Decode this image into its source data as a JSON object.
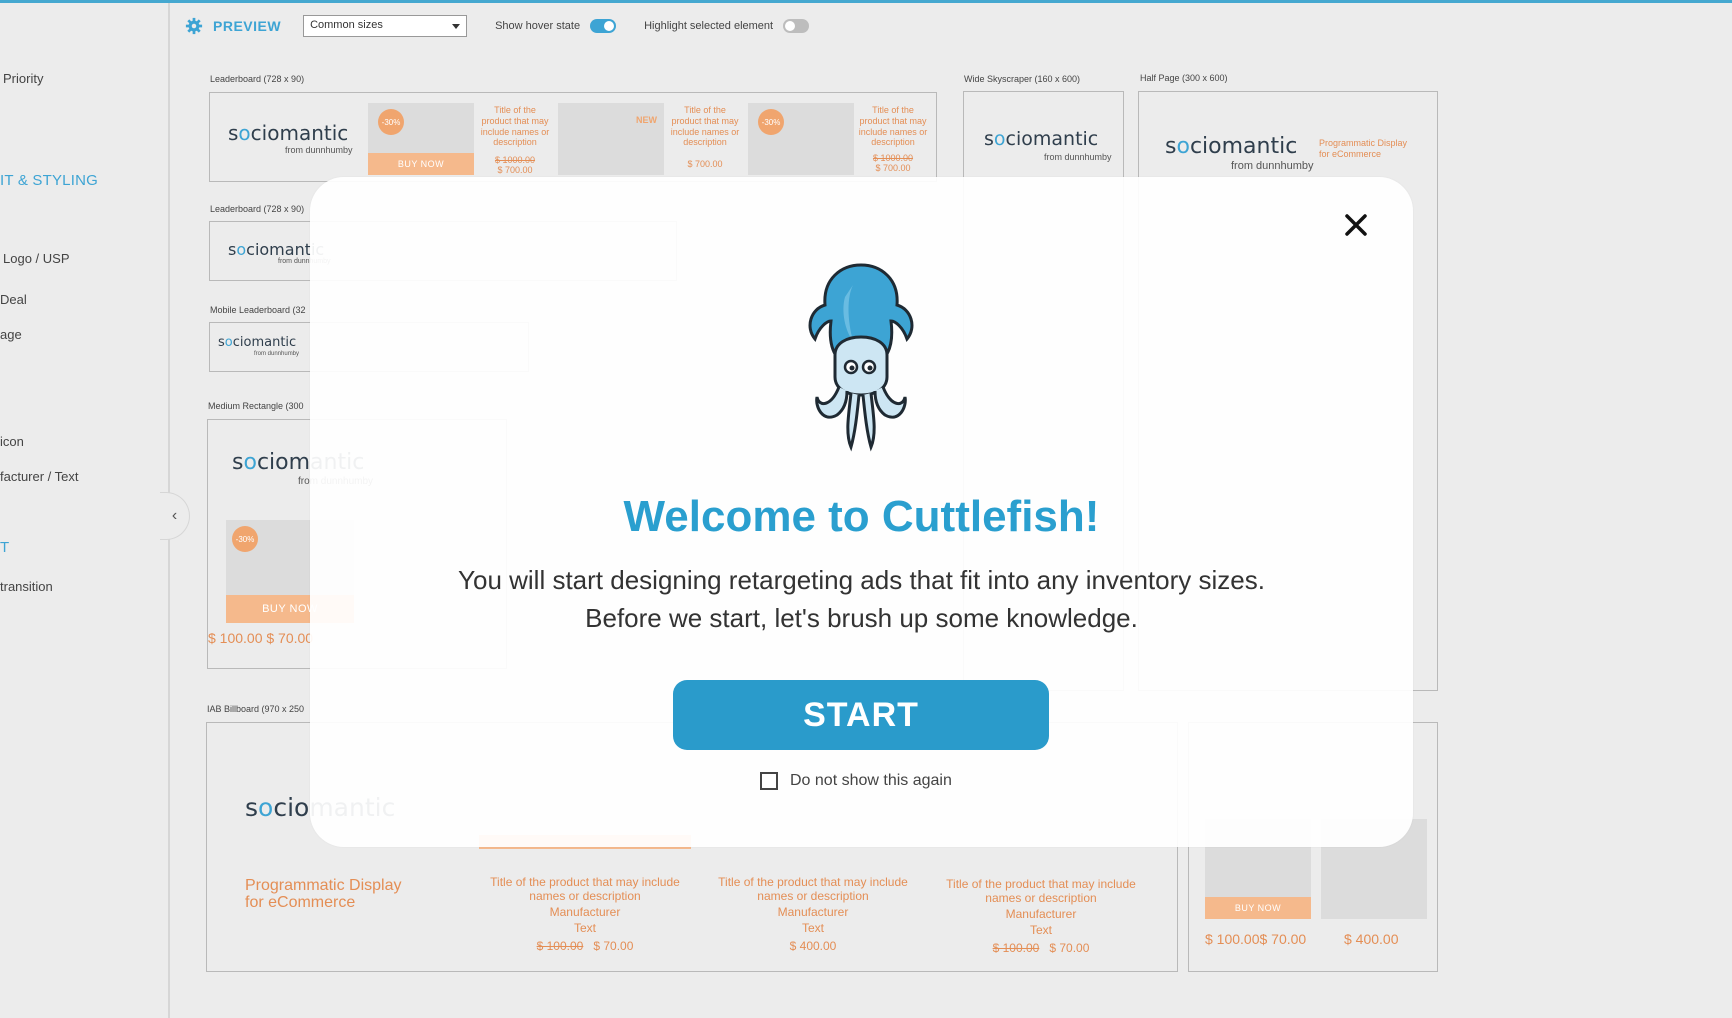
{
  "sidebar": {
    "items": [
      {
        "label": "Priority"
      },
      {
        "label": "IT & STYLING"
      },
      {
        "label": "Logo / USP"
      },
      {
        "label": "Deal"
      },
      {
        "label": "age"
      },
      {
        "label": "icon"
      },
      {
        "label": "facturer / Text"
      },
      {
        "label": "T"
      },
      {
        "label": "transition"
      }
    ]
  },
  "toolbar": {
    "preview_label": "PREVIEW",
    "size_select_value": "Common sizes",
    "show_hover_label": "Show hover state",
    "show_hover_on": true,
    "highlight_label": "Highlight selected element",
    "highlight_on": false
  },
  "ads": {
    "leaderboard1_label": "Leaderboard (728 x 90)",
    "leaderboard2_label": "Leaderboard (728 x 90)",
    "mobile_leaderboard_label": "Mobile Leaderboard (32",
    "medium_rect_label": "Medium Rectangle (300",
    "billboard_label": "IAB Billboard (970 x 250",
    "wide_sky_label": "Wide Skyscraper (160 x 600)",
    "half_page_label": "Half Page (300 x 600)",
    "logo_prefix": "s",
    "logo_o": "o",
    "logo_suffix": "ciomantic",
    "logo_sub": "from dunnhumby",
    "tagline": "Programmatic Display for eCommerce",
    "tagline_line1": "Programmatic Display",
    "tagline_line2": "for eCommerce",
    "badge_30": "-30%",
    "badge_new": "NEW",
    "buy_now": "BUY NOW",
    "buy_now_caps": "BUY NOW",
    "product_title": "Title of the product that may include names or description",
    "manufacturer": "Manufacturer",
    "text": "Text",
    "price_old_1000": "$ 1000.00",
    "price_700": "$ 700.00",
    "price_old_100": "$ 100.00",
    "price_70": "$ 70.00",
    "price_400": "$ 400.00",
    "mr_price": "$ 100.00 $ 70.00",
    "sq_price_old": "$ 100.00",
    "sq_price_new": "$ 70.00",
    "sq_price2": "$ 400.00"
  },
  "modal": {
    "title": "Welcome to Cuttlefish!",
    "line1": "You will start designing retargeting ads that fit into any inventory sizes.",
    "line2": "Before we start, let's brush up some knowledge.",
    "start_label": "START",
    "dont_show_label": "Do not show this again"
  },
  "colors": {
    "accent": "#2a9bcb",
    "orange": "#e48e55"
  }
}
